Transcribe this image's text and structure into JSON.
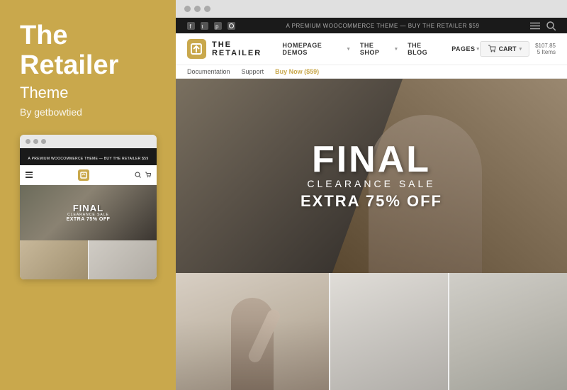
{
  "left": {
    "title_line1": "The",
    "title_line2": "Retailer",
    "subtitle": "Theme",
    "author": "By getbowtied"
  },
  "mini_browser": {
    "topbar_text": "A PREMIUM WOOCOMMERCE THEME — BUY THE RETAILER $59",
    "hero": {
      "final": "FINAL",
      "clearance": "CLEARANCE SALE",
      "extra": "EXTRA 75% OFF"
    }
  },
  "main_browser": {
    "topbar": {
      "promo_text": "A PREMIUM WOOCOMMERCE THEME — BUY THE RETAILER $59"
    },
    "nav": {
      "brand": "THE RETAILER",
      "menu_items": [
        {
          "label": "HOMEPAGE DEMOS",
          "has_dropdown": true
        },
        {
          "label": "THE SHOP",
          "has_dropdown": true
        },
        {
          "label": "THE BLOG",
          "has_dropdown": false
        },
        {
          "label": "PAGES",
          "has_dropdown": true
        }
      ],
      "cart": {
        "label": "CART",
        "amount": "$107.85",
        "items": "5 Items"
      }
    },
    "sub_nav": {
      "items": [
        "Documentation",
        "Support",
        "Buy Now ($59)"
      ]
    },
    "hero": {
      "final": "FINAL",
      "clearance": "CLEARANCE SALE",
      "extra": "EXTRA 75% OFF"
    }
  }
}
